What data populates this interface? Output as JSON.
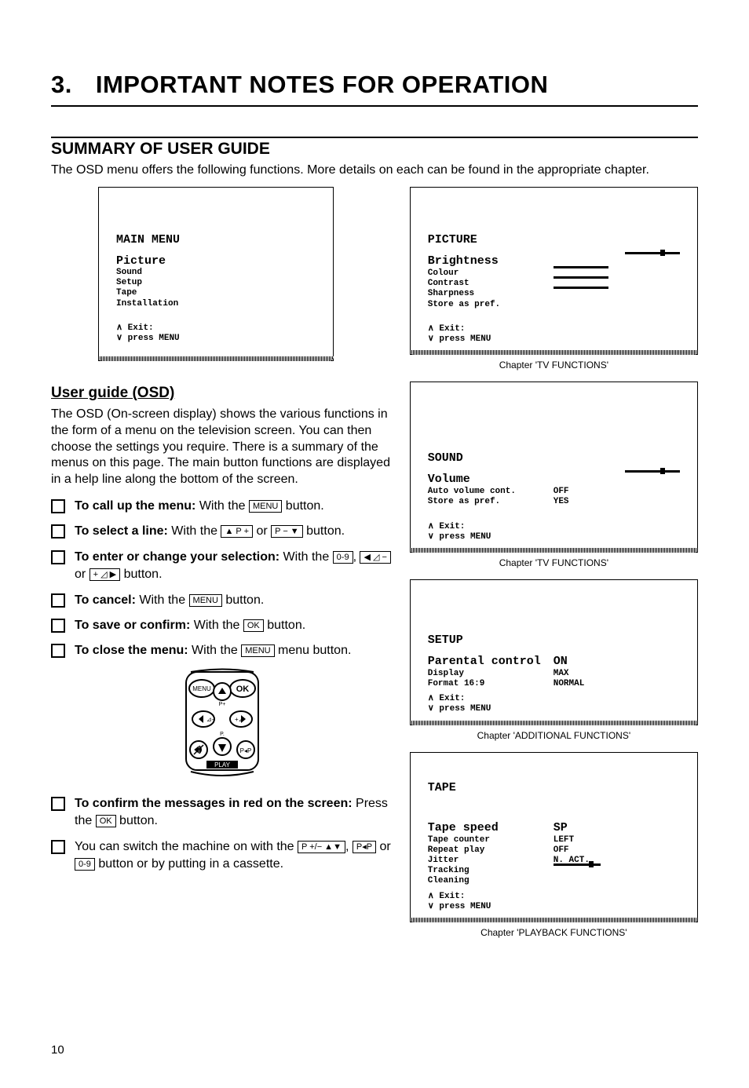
{
  "page_number": "10",
  "chapter_heading": {
    "num": "3.",
    "title": "IMPORTANT NOTES FOR OPERATION"
  },
  "section_heading": "SUMMARY OF USER GUIDE",
  "intro": "The OSD menu offers the following functions. More details on each can be found in the appropriate chapter.",
  "main_menu_osd": {
    "title": "MAIN MENU",
    "highlight": "Picture",
    "items": [
      "Sound",
      "Setup",
      "Tape",
      "Installation"
    ],
    "exit_top": "∧ Exit:",
    "exit_bottom": "∨ press MENU"
  },
  "picture_osd": {
    "title": "PICTURE",
    "highlight": "Brightness",
    "rows": [
      {
        "label": "Colour",
        "slider": true
      },
      {
        "label": "Contrast",
        "slider": true
      },
      {
        "label": "Sharpness",
        "slider": true
      },
      {
        "label": "Store as pref.",
        "slider": false
      }
    ],
    "exit_top": "∧ Exit:",
    "exit_bottom": "∨ press MENU",
    "caption": "Chapter 'TV FUNCTIONS'"
  },
  "sound_osd": {
    "title": "SOUND",
    "highlight": "Volume",
    "rows": [
      {
        "label": "Auto volume cont.",
        "value": "OFF"
      },
      {
        "label": "Store as pref.",
        "value": "YES"
      }
    ],
    "exit_top": "∧ Exit:",
    "exit_bottom": "∨ press MENU",
    "caption": "Chapter 'TV FUNCTIONS'"
  },
  "setup_osd": {
    "title": "SETUP",
    "highlight": "Parental control",
    "highlight_value": "ON",
    "rows": [
      {
        "label": "Display",
        "value": "MAX"
      },
      {
        "label": "Format 16:9",
        "value": "NORMAL"
      }
    ],
    "exit_top": "∧ Exit:",
    "exit_bottom": "∨ press MENU",
    "caption": "Chapter 'ADDITIONAL FUNCTIONS'"
  },
  "tape_osd": {
    "title": "TAPE",
    "highlight": "Tape speed",
    "highlight_value": "SP",
    "rows": [
      {
        "label": "Tape counter",
        "value": "LEFT"
      },
      {
        "label": "Repeat play",
        "value": "OFF"
      },
      {
        "label": "Jitter",
        "value": "N. ACT."
      },
      {
        "label": "Tracking",
        "value": ""
      },
      {
        "label": "Cleaning",
        "value": ""
      }
    ],
    "exit_top": "∧ Exit:",
    "exit_bottom": "∨ press MENU",
    "caption": "Chapter 'PLAYBACK FUNCTIONS'"
  },
  "userguide": {
    "heading": "User guide (OSD)",
    "para": "The OSD (On-screen display) shows the various functions in the form of a menu on the television screen. You can then choose the settings you require. There is a summary of the menus on this page. The main button functions are displayed in a help line along the bottom of the screen.",
    "steps": {
      "s1_b": "To call up the menu:",
      "s1_t1": " With the ",
      "s1_k1": "MENU",
      "s1_t2": " button.",
      "s2_b": "To select a line:",
      "s2_t1": " With the ",
      "s2_k1": "▲ P +",
      "s2_t2": " or ",
      "s2_k2": "P − ▼",
      "s2_t3": " button.",
      "s3_b": "To enter or change your selection:",
      "s3_t1": " With the ",
      "s3_k1": "0-9",
      "s3_t2": ", ",
      "s3_k2": "◀ ◿ −",
      "s3_t3": " or ",
      "s3_k3": "+ ◿ ▶",
      "s3_t4": " button.",
      "s4_b": "To cancel:",
      "s4_t1": " With the ",
      "s4_k1": "MENU",
      "s4_t2": " button.",
      "s5_b": "To save or confirm:",
      "s5_t1": " With the ",
      "s5_k1": "OK",
      "s5_t2": " button.",
      "s6_b": "To close the menu:",
      "s6_t1": " With the ",
      "s6_k1": "MENU",
      "s6_t2": " menu button.",
      "s7_b": "To confirm the messages in red on the screen:",
      "s7_t1": " Press the ",
      "s7_k1": "OK",
      "s7_t2": " button.",
      "s8_t1": "You can switch the machine on with the ",
      "s8_k1": "P +/− ▲▼",
      "s8_t2": ", ",
      "s8_k2": "P◂P",
      "s8_t3": " or ",
      "s8_k3": "0-9",
      "s8_t4": " button or by putting in a cassette."
    },
    "remote": {
      "menu": "MENU",
      "ok": "OK",
      "play": "PLAY",
      "pplus": "P+",
      "pchar": "P."
    }
  }
}
